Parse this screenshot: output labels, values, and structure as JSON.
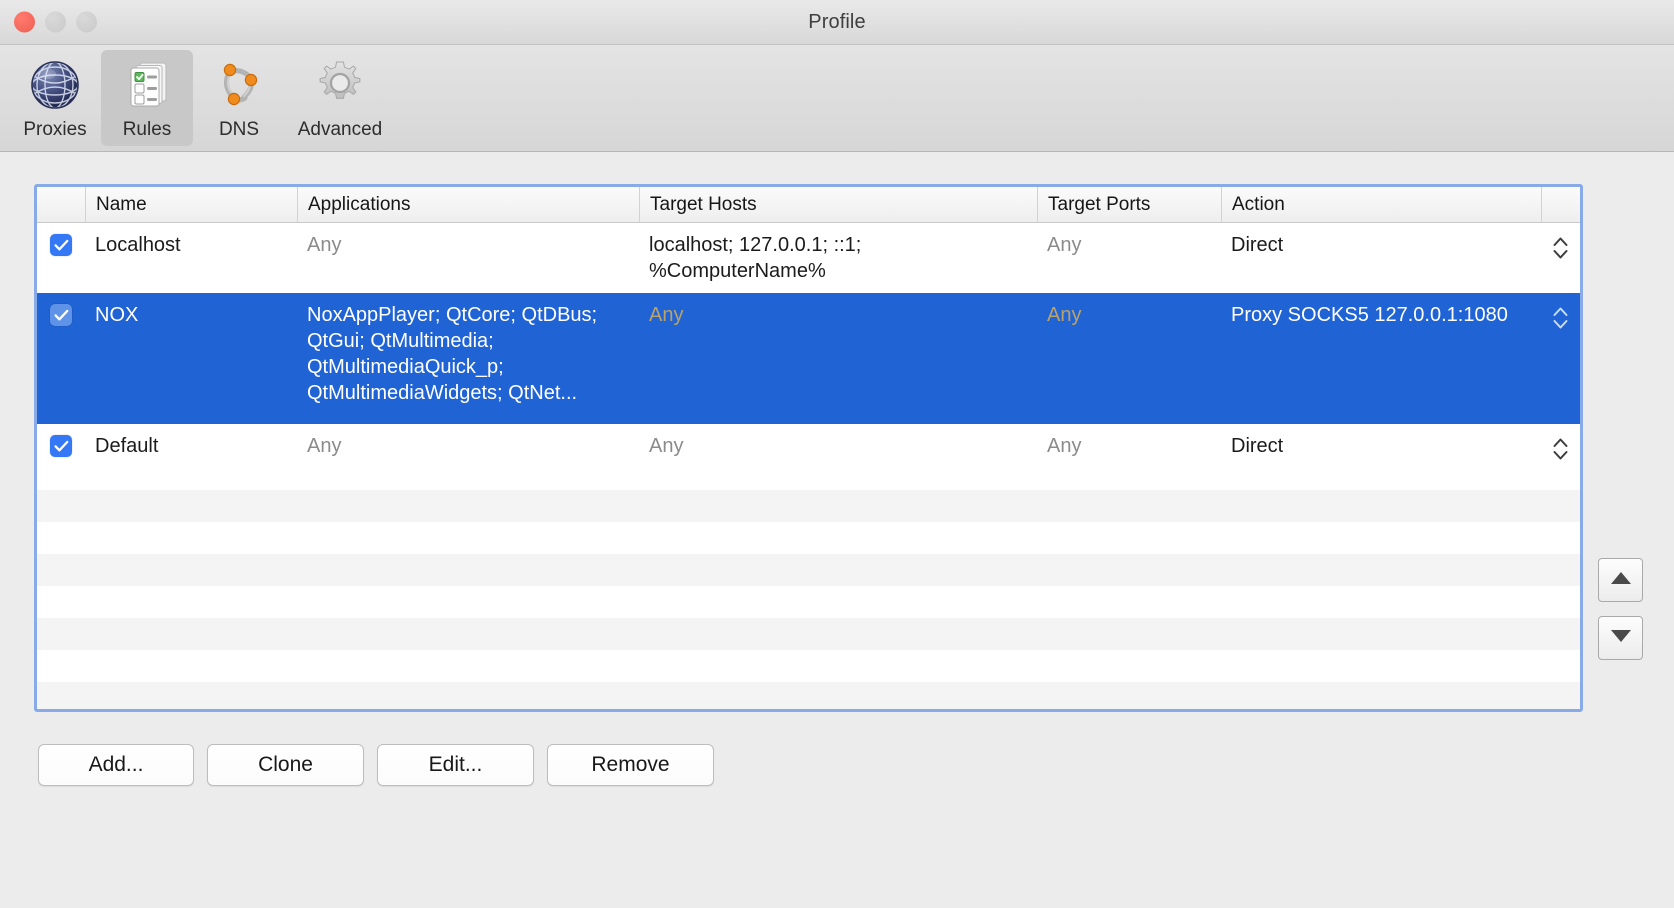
{
  "window": {
    "title": "Profile",
    "traffic_lights": [
      "close",
      "minimize",
      "maximize"
    ]
  },
  "toolbar": {
    "items": [
      {
        "label": "Proxies",
        "icon": "globe-icon",
        "selected": false
      },
      {
        "label": "Rules",
        "icon": "checklist-icon",
        "selected": true
      },
      {
        "label": "DNS",
        "icon": "dns-nodes-icon",
        "selected": false
      },
      {
        "label": "Advanced",
        "icon": "gear-icon",
        "selected": false
      }
    ]
  },
  "table": {
    "columns": [
      {
        "key": "check",
        "label": ""
      },
      {
        "key": "name",
        "label": "Name"
      },
      {
        "key": "apps",
        "label": "Applications"
      },
      {
        "key": "hosts",
        "label": "Target Hosts"
      },
      {
        "key": "ports",
        "label": "Target Ports"
      },
      {
        "key": "action",
        "label": "Action"
      }
    ],
    "rows": [
      {
        "checked": true,
        "name": "Localhost",
        "apps": "Any",
        "apps_muted": true,
        "hosts": "localhost; 127.0.0.1; ::1; %ComputerName%",
        "hosts_muted": false,
        "ports": "Any",
        "ports_muted": true,
        "action": "Direct",
        "selected": false
      },
      {
        "checked": true,
        "name": "NOX",
        "apps": "NoxAppPlayer; QtCore; QtDBus; QtGui; QtMultimedia; QtMultimediaQuick_p; QtMultimediaWidgets; QtNet...",
        "apps_muted": false,
        "hosts": "Any",
        "hosts_muted": true,
        "ports": "Any",
        "ports_muted": true,
        "action": "Proxy SOCKS5 127.0.0.1:1080",
        "selected": true
      },
      {
        "checked": true,
        "name": "Default",
        "apps": "Any",
        "apps_muted": true,
        "hosts": "Any",
        "hosts_muted": true,
        "ports": "Any",
        "ports_muted": true,
        "action": "Direct",
        "selected": false
      }
    ],
    "empty_row_count": 9
  },
  "reorder": {
    "move_up_label": "move-up",
    "move_down_label": "move-down"
  },
  "footer": {
    "buttons": [
      {
        "label": "Add...",
        "name": "add-button"
      },
      {
        "label": "Clone",
        "name": "clone-button"
      },
      {
        "label": "Edit...",
        "name": "edit-button"
      },
      {
        "label": "Remove",
        "name": "remove-button"
      }
    ]
  },
  "colors": {
    "selection_blue": "#2063d4",
    "focus_ring": "#88aae6",
    "checkbox_blue": "#3478f6",
    "muted_text": "#8b8b8b",
    "window_bg": "#ececec"
  }
}
